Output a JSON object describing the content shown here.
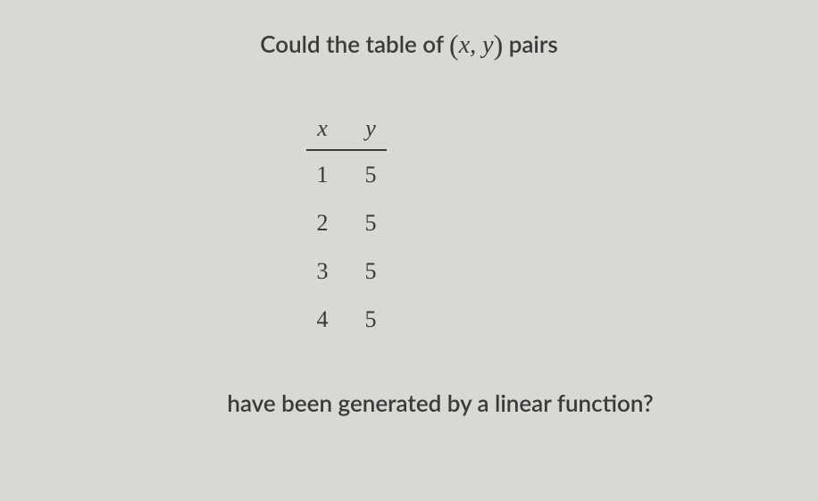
{
  "question": {
    "line1_prefix": "Could the table of ",
    "paren_open": "(",
    "var_x": "x",
    "comma": ", ",
    "var_y": "y",
    "paren_close": ")",
    "line1_suffix": " pairs",
    "line2": "have been generated by a linear function?"
  },
  "table": {
    "header_x": "x",
    "header_y": "y",
    "rows": [
      {
        "x": "1",
        "y": "5"
      },
      {
        "x": "2",
        "y": "5"
      },
      {
        "x": "3",
        "y": "5"
      },
      {
        "x": "4",
        "y": "5"
      }
    ]
  },
  "chart_data": {
    "type": "table",
    "columns": [
      "x",
      "y"
    ],
    "rows": [
      [
        1,
        5
      ],
      [
        2,
        5
      ],
      [
        3,
        5
      ],
      [
        4,
        5
      ]
    ]
  }
}
